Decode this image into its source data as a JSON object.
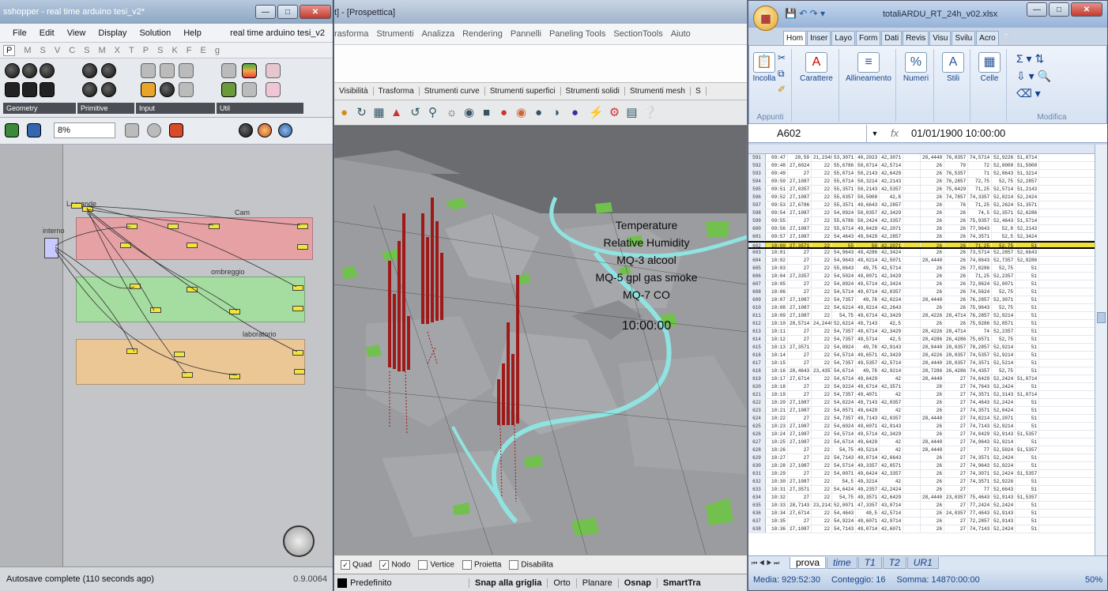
{
  "grasshopper": {
    "title": "sshopper - real time arduino tesi_v2*",
    "menu": [
      "File",
      "Edit",
      "View",
      "Display",
      "Solution",
      "Help"
    ],
    "doc_name": "real time arduino tesi_v2",
    "category_tabs": [
      "P",
      "M",
      "S",
      "V",
      "C",
      "S",
      "M",
      "X",
      "T",
      "P",
      "S",
      "K",
      "F",
      "E",
      "g"
    ],
    "panels": [
      "Geometry",
      "Primitive",
      "Input",
      "Util"
    ],
    "zoom": "8%",
    "group_labels": [
      "Cam",
      "ombreggio",
      "Lagrande",
      "interno",
      "laboratorio"
    ],
    "status": "Autosave complete (110 seconds ago)",
    "version": "0.9.0064"
  },
  "rhino": {
    "title": "t] - [Prospettica]",
    "menu": [
      "rasforma",
      "Strumenti",
      "Analizza",
      "Rendering",
      "Pannelli",
      "Paneling Tools",
      "SectionTools",
      "Aiuto"
    ],
    "tabs": [
      "Visibilità",
      "Trasforma",
      "Strumenti curve",
      "Strumenti superfici",
      "Strumenti solidi",
      "Strumenti mesh",
      "S"
    ],
    "overlay_lines": [
      "Temperature",
      "Relative Humidity",
      "MQ-3 alcool",
      "MQ-5 gpl gas smoke",
      "MQ-7 CO"
    ],
    "overlay_time": "10:00:00",
    "osnap": [
      {
        "label": "Quad",
        "checked": true
      },
      {
        "label": "Nodo",
        "checked": true
      },
      {
        "label": "Vertice",
        "checked": false
      },
      {
        "label": "Proietta",
        "checked": false
      },
      {
        "label": "Disabilita",
        "checked": false
      }
    ],
    "layer": "Predefinito",
    "status_panes": [
      "Snap alla griglia",
      "Orto",
      "Planare",
      "Osnap",
      "SmartTra"
    ]
  },
  "excel": {
    "title": "totaliARDU_RT_24h_v02.xlsx",
    "ribbon_tabs": [
      "Hom",
      "Inser",
      "Layo",
      "Form",
      "Dati",
      "Revis",
      "Visu",
      "Svilu",
      "Acro"
    ],
    "groups": {
      "clipboard": {
        "button": "Incolla",
        "name": "Appunti"
      },
      "font": "Carattere",
      "align": "Allineamento",
      "number": "Numeri",
      "styles": "Stili",
      "cells": "Celle",
      "editing": "Modifica"
    },
    "name_box": "A602",
    "fx": "fx",
    "formula": "01/01/1900 10:00:00",
    "rows": [
      [
        "591",
        "09:47",
        "28,59",
        "21,2340",
        "53,3071",
        "40,2023",
        "42,3071",
        "",
        "28,4440",
        "76,0357",
        "74,5714",
        "52,9226",
        "51,0714"
      ],
      [
        "592",
        "09:48",
        "27,6024",
        "22",
        "55,6786",
        "50,0714",
        "42,5714",
        "",
        "26",
        "79",
        "72",
        "52,0000",
        "51,5000"
      ],
      [
        "593",
        "09:49",
        "27",
        "22",
        "55,0714",
        "50,2143",
        "42,6429",
        "",
        "26",
        "76,5357",
        "71",
        "52,8643",
        "51,3214"
      ],
      [
        "594",
        "09:50",
        "27,1087",
        "22",
        "55,0714",
        "50,3214",
        "42,2143",
        "",
        "26",
        "76,2857",
        "72,75",
        "52,75",
        "52,2857"
      ],
      [
        "595",
        "09:51",
        "27,0357",
        "22",
        "55,3571",
        "50,2143",
        "42,5357",
        "",
        "26",
        "75,6429",
        "71,25",
        "52,5714",
        "51,2143"
      ],
      [
        "596",
        "09:52",
        "27,1087",
        "22",
        "55,0357",
        "50,5000",
        "42,8",
        "",
        "26",
        "74,7857",
        "74,3357",
        "52,8214",
        "52,2424"
      ],
      [
        "597",
        "09:53",
        "27,6786",
        "22",
        "55,3571",
        "49,6643",
        "42,2857",
        "",
        "26",
        "76",
        "71,25",
        "52,2624",
        "51,3571"
      ],
      [
        "598",
        "09:54",
        "27,1087",
        "22",
        "54,0924",
        "50,0357",
        "42,3429",
        "",
        "26",
        "26",
        "74,5",
        "52,3571",
        "52,6286"
      ],
      [
        "599",
        "09:55",
        "27",
        "22",
        "55,6786",
        "50,2424",
        "42,3357",
        "",
        "26",
        "26",
        "75,9357",
        "52,4643",
        "51,5714"
      ],
      [
        "600",
        "09:56",
        "27,1087",
        "22",
        "55,6714",
        "49,0429",
        "42,2071",
        "",
        "26",
        "26",
        "77,9643",
        "52,8",
        "52,2143"
      ],
      [
        "601",
        "09:57",
        "27,1087",
        "22",
        "54,4643",
        "49,9429",
        "42,2857",
        "",
        "26",
        "26",
        "74,3571",
        "52,5",
        "52,3424"
      ],
      [
        "602",
        "10:00",
        "27,3571",
        "22",
        "55",
        "50",
        "42,2071",
        "",
        "26",
        "26",
        "71,25",
        "52,75",
        "51"
      ],
      [
        "603",
        "10:01",
        "27",
        "22",
        "54,9643",
        "49,4286",
        "42,3424",
        "",
        "26",
        "26",
        "73,5714",
        "52,2857",
        "52,6643"
      ],
      [
        "604",
        "10:02",
        "27",
        "22",
        "54,9643",
        "49,0214",
        "42,5071",
        "",
        "28,4440",
        "26",
        "74,8643",
        "52,7357",
        "52,9286"
      ],
      [
        "605",
        "10:03",
        "27",
        "22",
        "55,0643",
        "49,75",
        "42,5714",
        "",
        "26",
        "26",
        "77,0286",
        "52,75",
        "51"
      ],
      [
        "606",
        "10:04",
        "27,3357",
        "22",
        "54,5024",
        "49,0071",
        "42,3429",
        "",
        "26",
        "26",
        "71,25",
        "52,2357",
        "51"
      ],
      [
        "607",
        "10:05",
        "27",
        "22",
        "54,0924",
        "49,5714",
        "42,3424",
        "",
        "26",
        "26",
        "72,8624",
        "52,0071",
        "51"
      ],
      [
        "608",
        "10:06",
        "27",
        "22",
        "54,5714",
        "49,0714",
        "42,0357",
        "",
        "26",
        "26",
        "74,5624",
        "52,75",
        "51"
      ],
      [
        "609",
        "10:07",
        "27,1087",
        "22",
        "54,7357",
        "49,78",
        "42,0224",
        "",
        "28,4440",
        "26",
        "76,2857",
        "52,3071",
        "51"
      ],
      [
        "610",
        "10:08",
        "27,1087",
        "22",
        "54,6214",
        "49,0214",
        "42,2643",
        "",
        "26",
        "26",
        "75,9643",
        "52,75",
        "51"
      ],
      [
        "611",
        "10:09",
        "27,1087",
        "22",
        "54,75",
        "49,6714",
        "42,3429",
        "",
        "28,4226",
        "28,4714",
        "76,2857",
        "52,9214",
        "51"
      ],
      [
        "612",
        "10:10",
        "28,5714",
        "24,2440",
        "52,6214",
        "49,7143",
        "42,5",
        "",
        "26",
        "26",
        "75,9286",
        "52,8571",
        "51"
      ],
      [
        "613",
        "10:11",
        "27",
        "22",
        "54,7357",
        "49,6714",
        "42,3429",
        "",
        "28,4226",
        "28,4714",
        "74",
        "52,2357",
        "51"
      ],
      [
        "614",
        "10:12",
        "27",
        "22",
        "54,7357",
        "49,5714",
        "42,5",
        "",
        "28,4286",
        "26,4286",
        "75,6571",
        "52,75",
        "51"
      ],
      [
        "615",
        "10:13",
        "27,3571",
        "22",
        "54,0924",
        "49,78",
        "42,9143",
        "",
        "28,9440",
        "28,0357",
        "78,2857",
        "52,9214",
        "51"
      ],
      [
        "616",
        "10:14",
        "27",
        "22",
        "54,5714",
        "49,6571",
        "42,3429",
        "",
        "28,4226",
        "28,0357",
        "74,5357",
        "52,9214",
        "51"
      ],
      [
        "617",
        "10:15",
        "27",
        "22",
        "54,7357",
        "49,5357",
        "42,5714",
        "",
        "28,4440",
        "28,0357",
        "74,3571",
        "52,5214",
        "51"
      ],
      [
        "618",
        "10:16",
        "28,4643",
        "23,4357",
        "54,6714",
        "49,78",
        "42,9214",
        "",
        "28,7286",
        "26,4286",
        "74,4357",
        "52,75",
        "51"
      ],
      [
        "619",
        "10:17",
        "27,6714",
        "22",
        "54,6714",
        "49,6429",
        "42",
        "",
        "28,4440",
        "27",
        "74,6429",
        "52,2424",
        "51,0714"
      ],
      [
        "620",
        "10:18",
        "27",
        "22",
        "54,9224",
        "49,6714",
        "42,3571",
        "",
        "28",
        "27",
        "74,7643",
        "52,2424",
        "51"
      ],
      [
        "621",
        "10:19",
        "27",
        "22",
        "54,7357",
        "49,4071",
        "42",
        "",
        "26",
        "27",
        "74,3571",
        "52,3143",
        "51,0714"
      ],
      [
        "622",
        "10:20",
        "27,1087",
        "22",
        "54,0224",
        "49,7143",
        "42,0357",
        "",
        "26",
        "27",
        "74,4643",
        "52,2424",
        "51"
      ],
      [
        "623",
        "10:21",
        "27,1087",
        "22",
        "54,0571",
        "49,6429",
        "42",
        "",
        "26",
        "27",
        "74,3571",
        "52,0424",
        "51"
      ],
      [
        "624",
        "10:22",
        "27",
        "22",
        "54,7357",
        "49,7143",
        "42,0357",
        "",
        "28,4440",
        "27",
        "74,8214",
        "52,2071",
        "51"
      ],
      [
        "625",
        "10:23",
        "27,1087",
        "22",
        "54,6024",
        "49,6071",
        "42,9143",
        "",
        "26",
        "27",
        "74,7143",
        "52,9214",
        "51"
      ],
      [
        "626",
        "10:24",
        "27,1087",
        "22",
        "54,5714",
        "49,5714",
        "42,3429",
        "",
        "26",
        "27",
        "74,0429",
        "52,9143",
        "51,5357"
      ],
      [
        "627",
        "10:25",
        "27,1087",
        "22",
        "54,6714",
        "49,6429",
        "42",
        "",
        "28,4440",
        "27",
        "74,9643",
        "52,9214",
        "51"
      ],
      [
        "628",
        "10:26",
        "27",
        "22",
        "54,75",
        "49,5214",
        "42",
        "",
        "28,4440",
        "27",
        "77",
        "52,5024",
        "51,5357"
      ],
      [
        "629",
        "10:27",
        "27",
        "22",
        "54,7143",
        "49,0714",
        "42,6643",
        "",
        "26",
        "27",
        "74,3571",
        "52,2424",
        "51"
      ],
      [
        "630",
        "10:28",
        "27,1087",
        "22",
        "54,5714",
        "49,3357",
        "42,0571",
        "",
        "26",
        "27",
        "74,9643",
        "52,9224",
        "51"
      ],
      [
        "631",
        "10:29",
        "27",
        "22",
        "54,0071",
        "49,6424",
        "42,3357",
        "",
        "26",
        "27",
        "74,3071",
        "52,2424",
        "51,5357"
      ],
      [
        "632",
        "10:30",
        "27,1087",
        "22",
        "54,5",
        "49,3214",
        "42",
        "",
        "26",
        "27",
        "74,3571",
        "52,9226",
        "51"
      ],
      [
        "633",
        "10:31",
        "27,3571",
        "22",
        "54,6424",
        "49,2357",
        "42,2424",
        "",
        "26",
        "27",
        "77",
        "52,6643",
        "51"
      ],
      [
        "634",
        "10:32",
        "27",
        "22",
        "54,75",
        "49,3571",
        "42,6429",
        "",
        "28,4440",
        "23,0357",
        "75,4643",
        "52,9143",
        "51,5357"
      ],
      [
        "635",
        "10:33",
        "28,7143",
        "23,2143",
        "52,0071",
        "47,3357",
        "43,0714",
        "",
        "26",
        "27",
        "77,2424",
        "52,2424",
        "51"
      ],
      [
        "636",
        "10:34",
        "27,6714",
        "22",
        "54,4643",
        "49,5",
        "42,5714",
        "",
        "26",
        "24,0357",
        "77,4643",
        "52,9143",
        "51"
      ],
      [
        "637",
        "10:35",
        "27",
        "22",
        "54,9224",
        "49,6071",
        "42,9714",
        "",
        "26",
        "27",
        "72,2857",
        "52,9143",
        "51"
      ],
      [
        "638",
        "10:36",
        "27,1087",
        "22",
        "54,7143",
        "49,0714",
        "42,6071",
        "",
        "26",
        "27",
        "74,7143",
        "52,2424",
        "51"
      ]
    ],
    "sheet_tabs": [
      "prova",
      "time",
      "T1",
      "T2",
      "UR1"
    ],
    "status": {
      "media": "Media: 929:52:30",
      "count": "Conteggio: 16",
      "sum": "Somma: 14870:00:00",
      "zoom": "50%"
    }
  }
}
